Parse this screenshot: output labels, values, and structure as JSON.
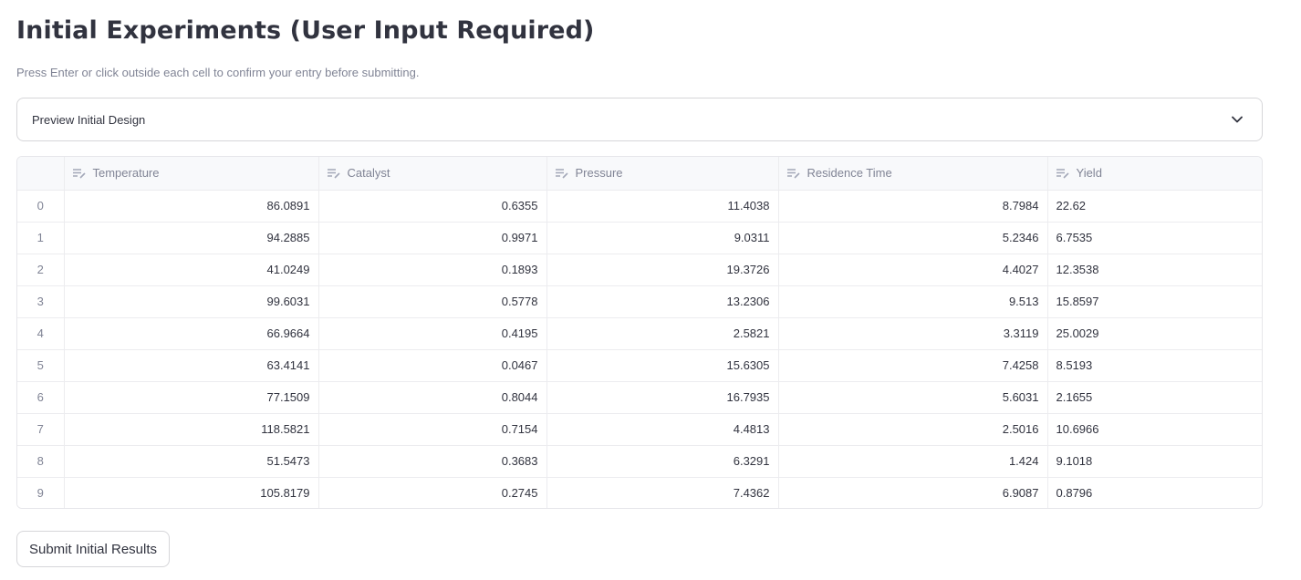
{
  "page": {
    "title": "Initial Experiments (User Input Required)",
    "caption": "Press Enter or click outside each cell to confirm your entry before submitting."
  },
  "expander": {
    "label": "Preview Initial Design",
    "icon": "chevron-down-icon"
  },
  "table": {
    "columns": [
      "Temperature",
      "Catalyst",
      "Pressure",
      "Residence Time",
      "Yield"
    ],
    "column_icon": "edit-column-icon",
    "rows": [
      {
        "index": "0",
        "cells": [
          "86.0891",
          "0.6355",
          "11.4038",
          "8.7984",
          "22.62"
        ]
      },
      {
        "index": "1",
        "cells": [
          "94.2885",
          "0.9971",
          "9.0311",
          "5.2346",
          "6.7535"
        ]
      },
      {
        "index": "2",
        "cells": [
          "41.0249",
          "0.1893",
          "19.3726",
          "4.4027",
          "12.3538"
        ]
      },
      {
        "index": "3",
        "cells": [
          "99.6031",
          "0.5778",
          "13.2306",
          "9.513",
          "15.8597"
        ]
      },
      {
        "index": "4",
        "cells": [
          "66.9664",
          "0.4195",
          "2.5821",
          "3.3119",
          "25.0029"
        ]
      },
      {
        "index": "5",
        "cells": [
          "63.4141",
          "0.0467",
          "15.6305",
          "7.4258",
          "8.5193"
        ]
      },
      {
        "index": "6",
        "cells": [
          "77.1509",
          "0.8044",
          "16.7935",
          "5.6031",
          "2.1655"
        ]
      },
      {
        "index": "7",
        "cells": [
          "118.5821",
          "0.7154",
          "4.4813",
          "2.5016",
          "10.6966"
        ]
      },
      {
        "index": "8",
        "cells": [
          "51.5473",
          "0.3683",
          "6.3291",
          "1.424",
          "9.1018"
        ]
      },
      {
        "index": "9",
        "cells": [
          "105.8179",
          "0.2745",
          "7.4362",
          "6.9087",
          "0.8796"
        ]
      }
    ]
  },
  "actions": {
    "submit_label": "Submit Initial Results"
  }
}
